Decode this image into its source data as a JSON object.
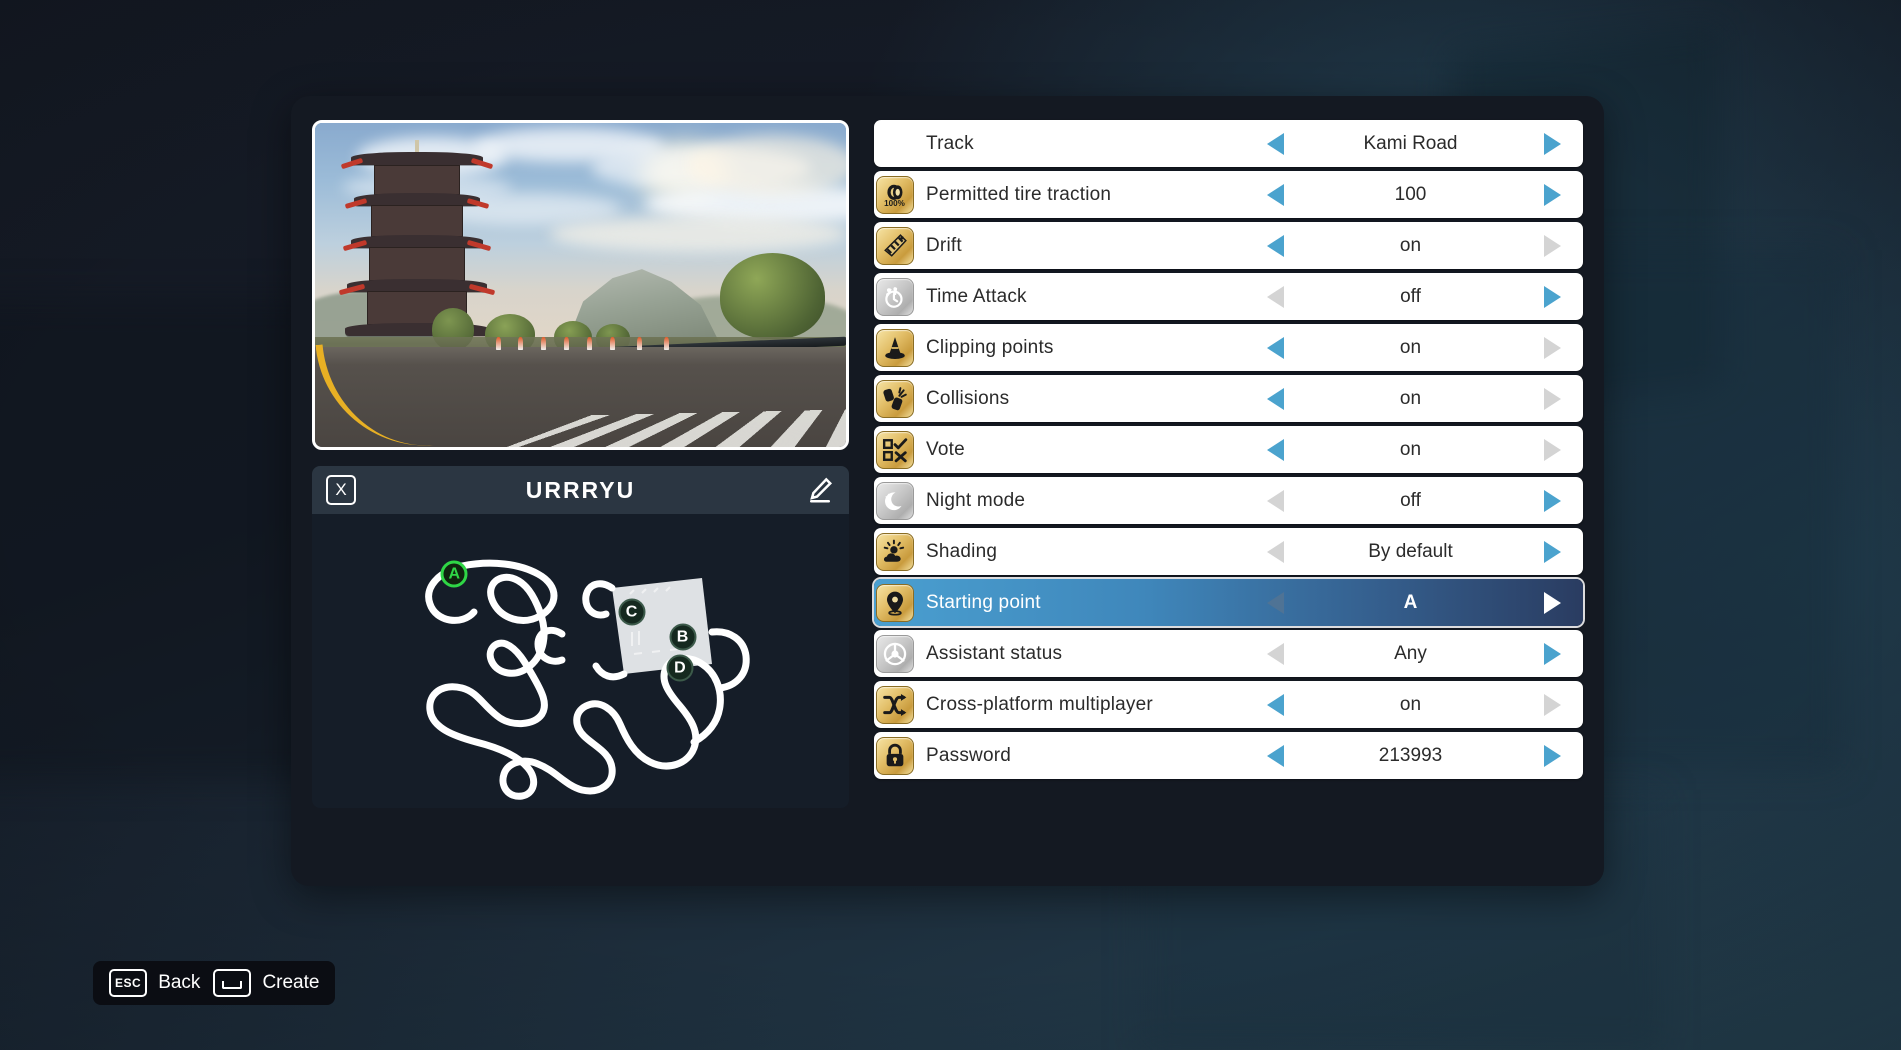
{
  "preview": {
    "scene_name": "pagoda-track-preview"
  },
  "room": {
    "close_label": "X",
    "name": "URRRYU",
    "edit_icon": "pencil-icon"
  },
  "minimap": {
    "markers": [
      {
        "label": "A",
        "x": 26.5,
        "y": 20.5,
        "active": true
      },
      {
        "label": "B",
        "x": 69.0,
        "y": 42.0,
        "active": false
      },
      {
        "label": "C",
        "x": 59.5,
        "y": 33.5,
        "active": false
      },
      {
        "label": "D",
        "x": 68.5,
        "y": 52.5,
        "active": false
      }
    ]
  },
  "settings": {
    "rows": [
      {
        "label": "Track",
        "value": "Kami Road",
        "icon": "none",
        "icon_active": false,
        "left_enabled": true,
        "right_enabled": true,
        "selected": false
      },
      {
        "label": "Permitted tire traction",
        "value": "100",
        "icon": "tire-icon",
        "icon_active": true,
        "left_enabled": true,
        "right_enabled": true,
        "selected": false
      },
      {
        "label": "Drift",
        "value": "on",
        "icon": "drift-icon",
        "icon_active": true,
        "left_enabled": true,
        "right_enabled": false,
        "selected": false
      },
      {
        "label": "Time Attack",
        "value": "off",
        "icon": "stopwatch-icon",
        "icon_active": false,
        "left_enabled": false,
        "right_enabled": true,
        "selected": false
      },
      {
        "label": "Clipping points",
        "value": "on",
        "icon": "cone-icon",
        "icon_active": true,
        "left_enabled": true,
        "right_enabled": false,
        "selected": false
      },
      {
        "label": "Collisions",
        "value": "on",
        "icon": "collision-icon",
        "icon_active": true,
        "left_enabled": true,
        "right_enabled": false,
        "selected": false
      },
      {
        "label": "Vote",
        "value": "on",
        "icon": "vote-icon",
        "icon_active": true,
        "left_enabled": true,
        "right_enabled": false,
        "selected": false
      },
      {
        "label": "Night mode",
        "value": "off",
        "icon": "moon-icon",
        "icon_active": false,
        "left_enabled": false,
        "right_enabled": true,
        "selected": false
      },
      {
        "label": "Shading",
        "value": "By default",
        "icon": "sun-cloud-icon",
        "icon_active": true,
        "left_enabled": false,
        "right_enabled": true,
        "selected": false
      },
      {
        "label": "Starting point",
        "value": "A",
        "icon": "map-pin-icon",
        "icon_active": true,
        "left_enabled": false,
        "right_enabled": true,
        "selected": true
      },
      {
        "label": "Assistant status",
        "value": "Any",
        "icon": "steering-icon",
        "icon_active": false,
        "left_enabled": false,
        "right_enabled": true,
        "selected": false
      },
      {
        "label": "Cross-platform multiplayer",
        "value": "on",
        "icon": "shuffle-icon",
        "icon_active": true,
        "left_enabled": true,
        "right_enabled": false,
        "selected": false
      },
      {
        "label": "Password",
        "value": "213993",
        "icon": "lock-icon",
        "icon_active": true,
        "left_enabled": true,
        "right_enabled": true,
        "selected": false
      }
    ]
  },
  "footer": {
    "hints": [
      {
        "key": "ESC",
        "key_type": "text",
        "label": "Back"
      },
      {
        "key": "SPACE",
        "key_type": "space",
        "label": "Create"
      }
    ]
  },
  "colors": {
    "accent_blue": "#4ba3ce",
    "disabled_grey": "#d4d4d4",
    "row_bg": "#ffffff",
    "panel_bg": "#141922",
    "selected_from": "#4a9fd0",
    "selected_to": "#2a3c61",
    "icon_gold": "#e3c06a",
    "marker_green": "#2fd646"
  }
}
